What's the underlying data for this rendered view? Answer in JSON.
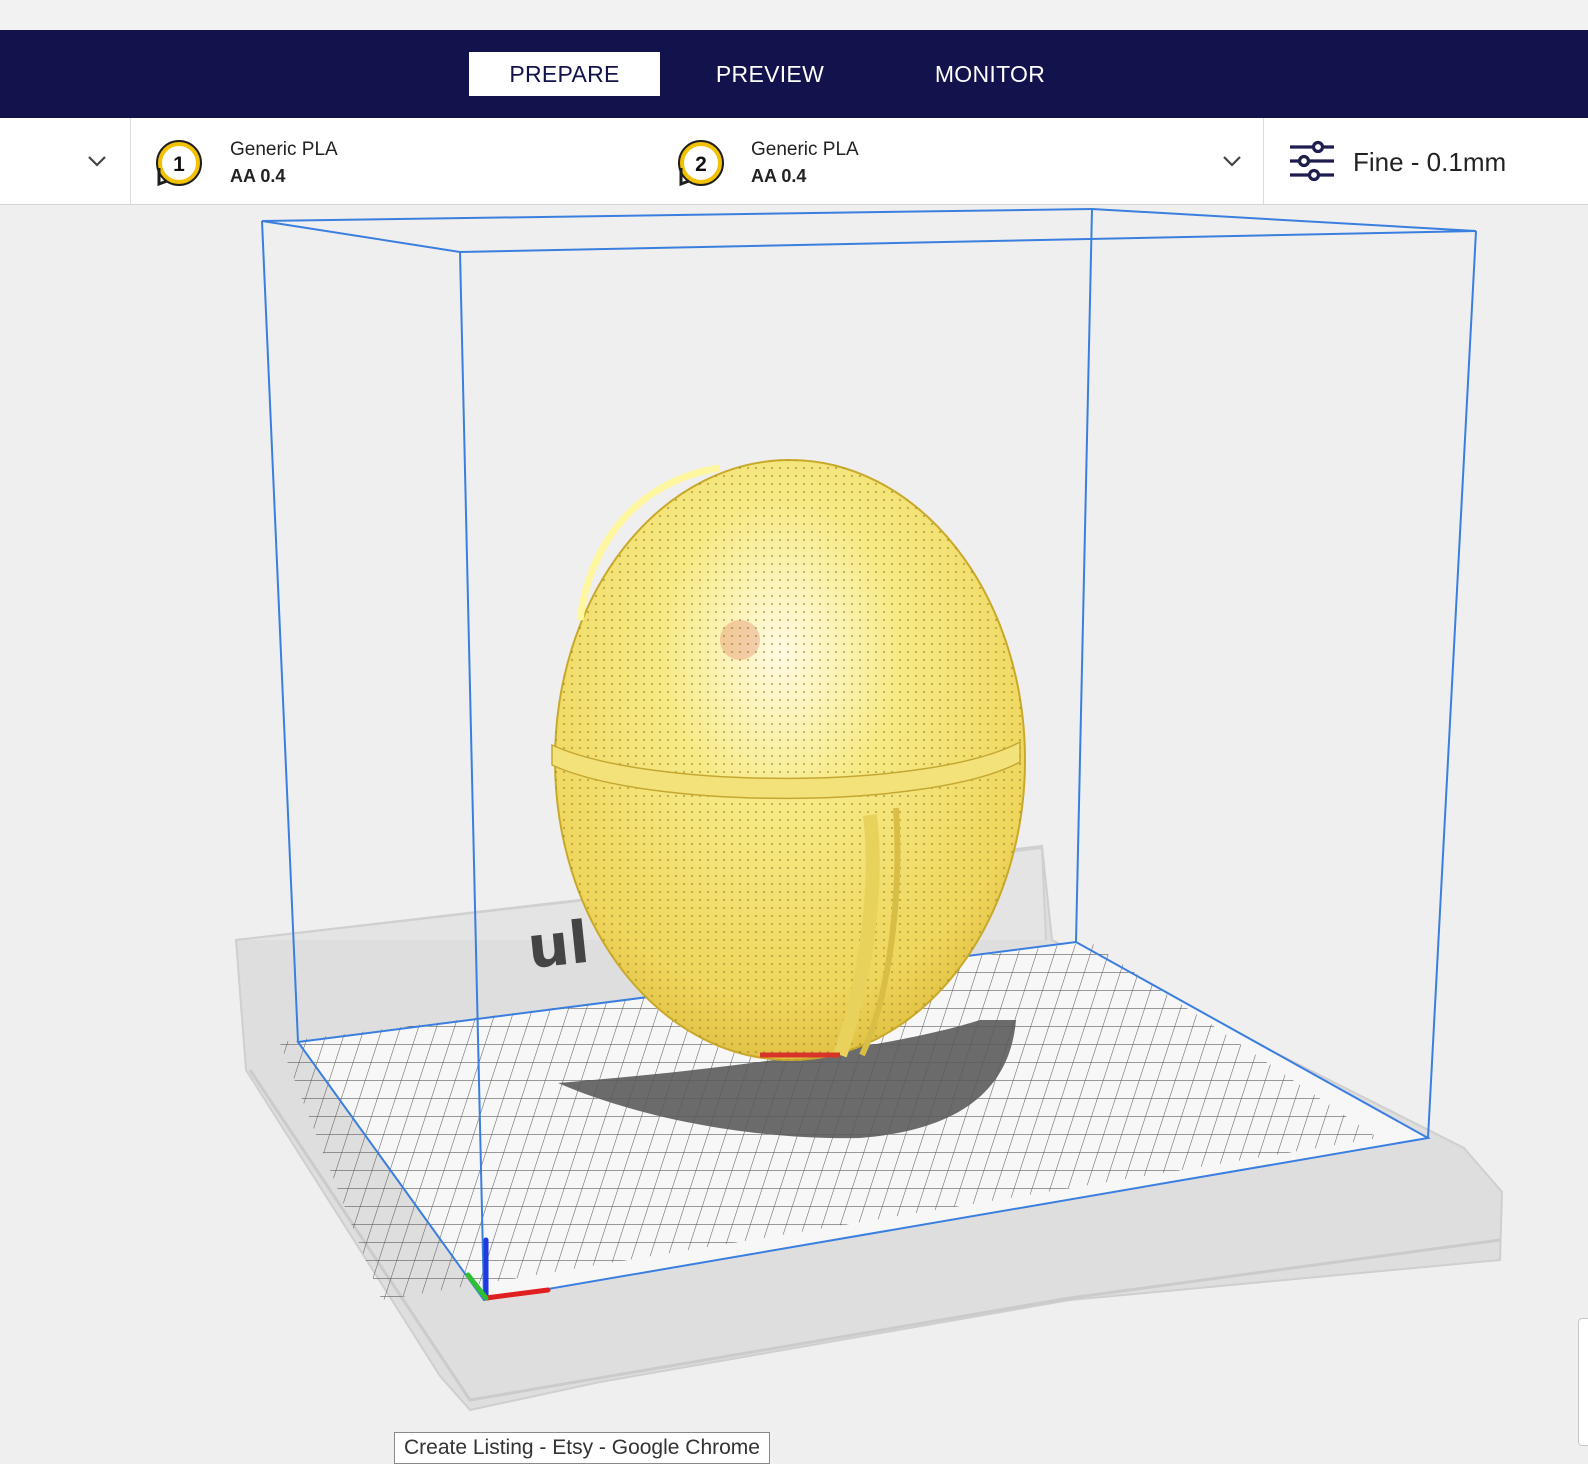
{
  "tabs": [
    {
      "label": "PREPARE",
      "active": true
    },
    {
      "label": "PREVIEW",
      "active": false
    },
    {
      "label": "MONITOR",
      "active": false
    }
  ],
  "extruders": [
    {
      "number": "1",
      "material": "Generic PLA",
      "nozzle": "AA 0.4"
    },
    {
      "number": "2",
      "material": "Generic PLA",
      "nozzle": "AA 0.4"
    }
  ],
  "print_profile": {
    "label": "Fine - 0.1mm"
  },
  "build_plate": {
    "brand_text": "ul"
  },
  "taskbar_tooltip": "Create Listing - Etsy - Google Chrome",
  "colors": {
    "nav_bg": "#12124d",
    "extruder_ring": "#f2c200",
    "model_yellow": "#f2e46a",
    "volume_outline": "#3a7fe0"
  },
  "icons": [
    "chevron-down-icon",
    "extruder-1-icon",
    "extruder-2-icon",
    "settings-sliders-icon",
    "axis-gizmo-icon"
  ]
}
